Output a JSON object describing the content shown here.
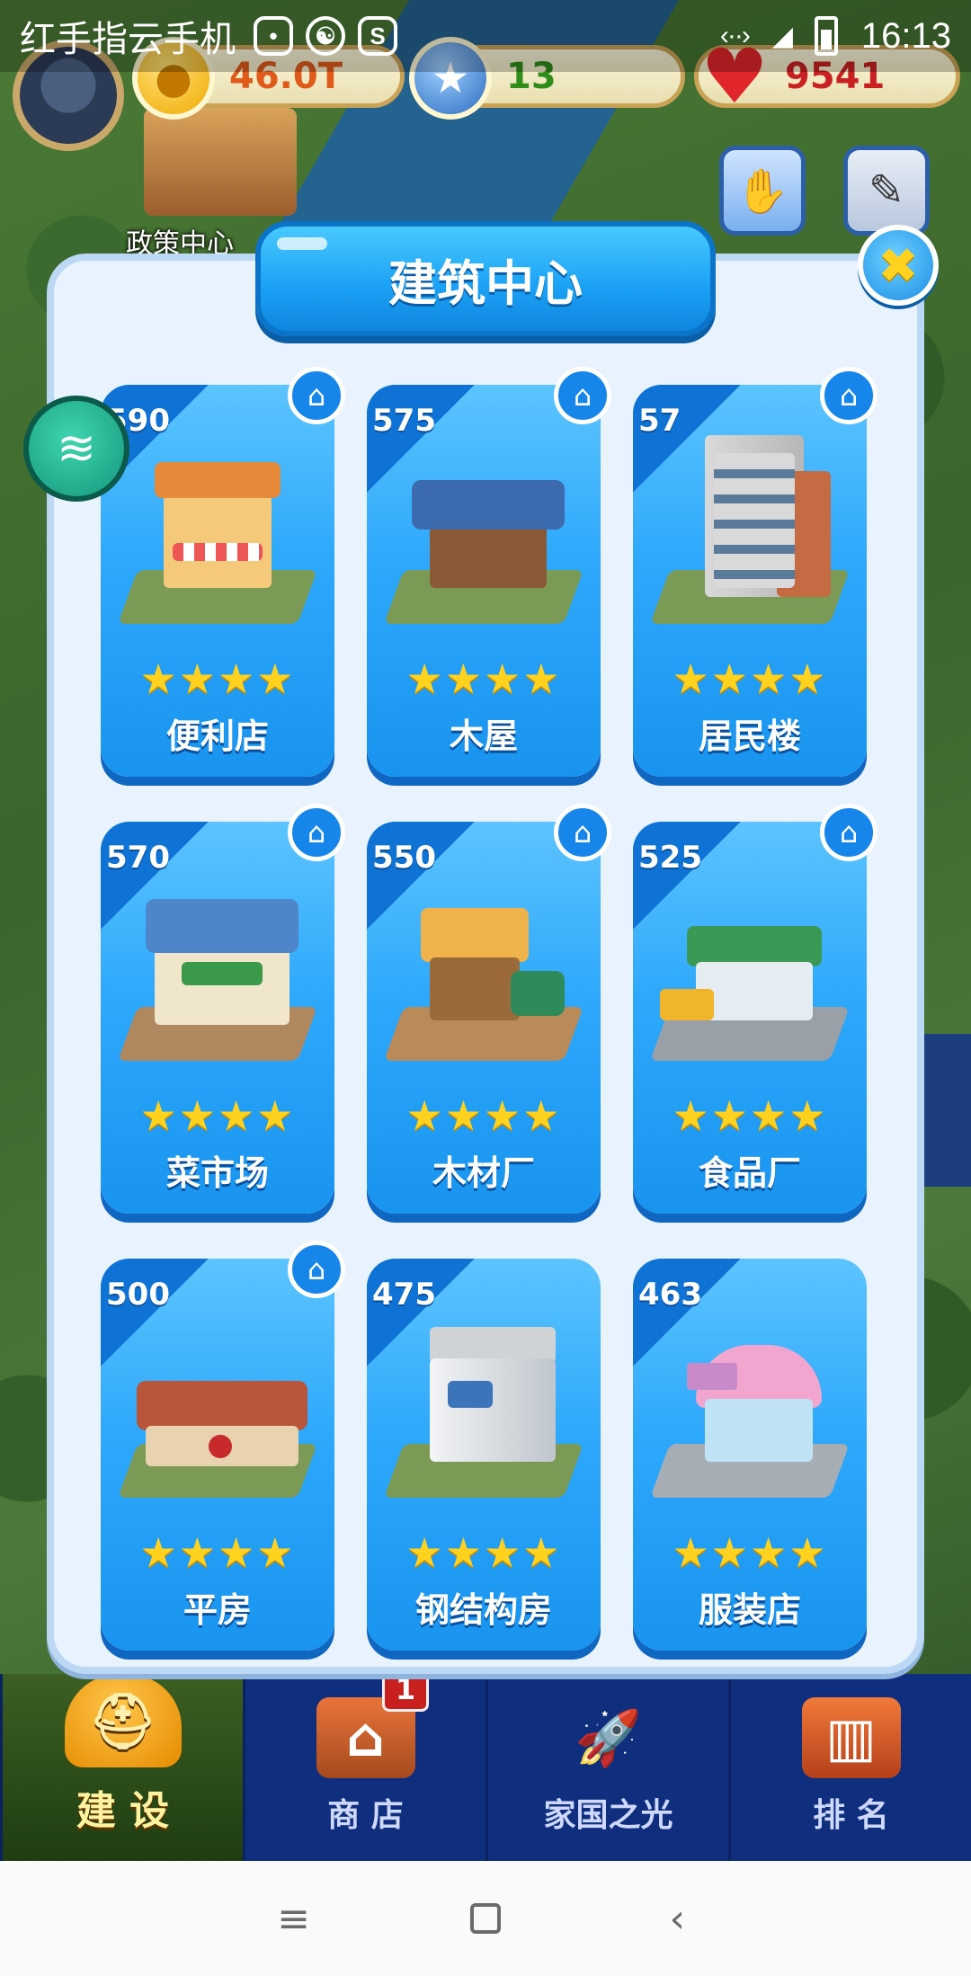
{
  "status_bar": {
    "carrier": "红手指云手机",
    "time": "16:13"
  },
  "resources": {
    "coins": "46.0T",
    "stars": "13",
    "hearts": "9541"
  },
  "map": {
    "policy_label": "政策中心"
  },
  "dialog": {
    "title": "建筑中心",
    "buildings": [
      {
        "score": "590",
        "name": "便利店",
        "stars": 4,
        "home": true
      },
      {
        "score": "575",
        "name": "木屋",
        "stars": 4,
        "home": true
      },
      {
        "score": "57",
        "name": "居民楼",
        "stars": 4,
        "home": true
      },
      {
        "score": "570",
        "name": "菜市场",
        "stars": 4,
        "home": true
      },
      {
        "score": "550",
        "name": "木材厂",
        "stars": 4,
        "home": true
      },
      {
        "score": "525",
        "name": "食品厂",
        "stars": 4,
        "home": true
      },
      {
        "score": "500",
        "name": "平房",
        "stars": 4,
        "home": true
      },
      {
        "score": "475",
        "name": "钢结构房",
        "stars": 4,
        "home": false
      },
      {
        "score": "463",
        "name": "服装店",
        "stars": 4,
        "home": false
      }
    ]
  },
  "tabs": [
    {
      "label": "建 设",
      "active": true
    },
    {
      "label": "商 店",
      "badge": "1"
    },
    {
      "label": "家国之光"
    },
    {
      "label": "排 名"
    }
  ],
  "colors": {
    "card_blue": "#2ea8fb",
    "star_gold": "#ffd21f",
    "tab_bar": "#0f2f7e"
  }
}
